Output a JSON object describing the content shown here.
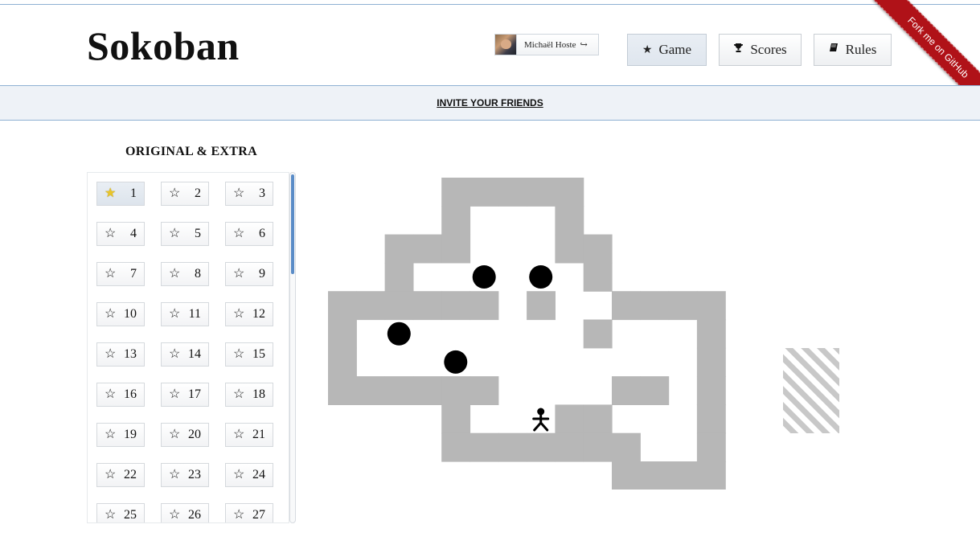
{
  "app": {
    "title": "Sokoban"
  },
  "user": {
    "name": "Michaël Hoste",
    "logout_icon": "sign-out-icon"
  },
  "nav": {
    "game": {
      "label": "Game",
      "icon": "star-icon"
    },
    "scores": {
      "label": "Scores",
      "icon": "trophy-icon"
    },
    "rules": {
      "label": "Rules",
      "icon": "book-icon"
    }
  },
  "ribbon": {
    "label": "Fork me on GitHub",
    "color": "#b01218"
  },
  "invite": {
    "label": "INVITE YOUR FRIENDS"
  },
  "levels": {
    "title": "ORIGINAL & EXTRA",
    "current": 1,
    "items": [
      {
        "label": "1"
      },
      {
        "label": "2"
      },
      {
        "label": "3"
      },
      {
        "label": "4"
      },
      {
        "label": "5"
      },
      {
        "label": "6"
      },
      {
        "label": "7"
      },
      {
        "label": "8"
      },
      {
        "label": "9"
      },
      {
        "label": "10"
      },
      {
        "label": "11"
      },
      {
        "label": "12"
      },
      {
        "label": "13"
      },
      {
        "label": "14"
      },
      {
        "label": "15"
      },
      {
        "label": "16"
      },
      {
        "label": "17"
      },
      {
        "label": "18"
      },
      {
        "label": "19"
      },
      {
        "label": "20"
      },
      {
        "label": "21"
      },
      {
        "label": "22"
      },
      {
        "label": "23"
      },
      {
        "label": "24"
      },
      {
        "label": "25"
      },
      {
        "label": "26"
      },
      {
        "label": "27"
      }
    ]
  },
  "board": {
    "colors": {
      "wall": "#b7b7b7",
      "floor": "#ffffff",
      "box": "#000000",
      "goal_stripe": "#c8c8c8"
    },
    "rows": [
      "    #####     ",
      "    #   #     ",
      "  ###   ##    ",
      "  #  $ $ #    ",
      "###### #  ####",
      "# $      #   #",
      "#   $        #",
      "######    ## #",
      "    #  @##   #",
      "    #######  #",
      "          ####"
    ],
    "legend": {
      "#": "wall",
      " ": "floor",
      "$": "box",
      "@": "player",
      ".": "goal"
    }
  }
}
